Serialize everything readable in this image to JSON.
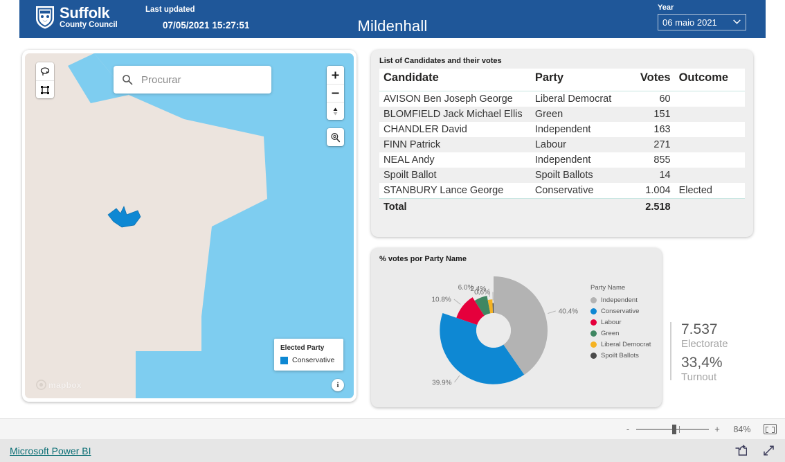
{
  "header": {
    "logo_title": "Suffolk",
    "logo_subtitle": "County Council",
    "last_updated_label": "Last updated",
    "last_updated_value": "07/05/2021 15:27:51",
    "page_title": "Mildenhall",
    "year_label": "Year",
    "year_selected": "06 maio 2021"
  },
  "map": {
    "search_placeholder": "Procurar",
    "zoom_in": "+",
    "zoom_out": "−",
    "legend_title": "Elected Party",
    "legend_item": "Conservative",
    "legend_color": "#0e88d3",
    "attribution": "mapbox",
    "info": "i"
  },
  "table": {
    "title": "List of Candidates and their votes",
    "columns": [
      "Candidate",
      "Party",
      "Votes",
      "Outcome"
    ],
    "rows": [
      {
        "candidate": "AVISON Ben Joseph George",
        "party": "Liberal Democrat",
        "votes": "60",
        "outcome": ""
      },
      {
        "candidate": "BLOMFIELD Jack Michael Ellis",
        "party": "Green",
        "votes": "151",
        "outcome": ""
      },
      {
        "candidate": "CHANDLER David",
        "party": "Independent",
        "votes": "163",
        "outcome": ""
      },
      {
        "candidate": "FINN Patrick",
        "party": "Labour",
        "votes": "271",
        "outcome": ""
      },
      {
        "candidate": "NEAL Andy",
        "party": "Independent",
        "votes": "855",
        "outcome": ""
      },
      {
        "candidate": "Spoilt Ballot",
        "party": "Spoilt Ballots",
        "votes": "14",
        "outcome": ""
      },
      {
        "candidate": "STANBURY Lance George",
        "party": "Conservative",
        "votes": "1.004",
        "outcome": "Elected"
      }
    ],
    "total_label": "Total",
    "total_votes": "2.518"
  },
  "kpi": {
    "electorate_value": "7.537",
    "electorate_label": "Electorate",
    "turnout_value": "33,4%",
    "turnout_label": "Turnout"
  },
  "footer": {
    "zoom_percent": "84%",
    "minus": "-",
    "plus": "+",
    "powerbi_link": "Microsoft Power BI"
  },
  "chart_data": {
    "type": "pie",
    "title": "% votes por Party Name",
    "legend_title": "Party Name",
    "legend_position": "right",
    "categories": [
      "Independent",
      "Conservative",
      "Labour",
      "Green",
      "Liberal Democrat",
      "Spoilt Ballots"
    ],
    "values": [
      40.4,
      39.9,
      10.8,
      6.0,
      2.4,
      0.6
    ],
    "labels": [
      "40.4%",
      "39.9%",
      "10.8%",
      "6.0%",
      "2.4%",
      "0.6%"
    ],
    "colors": [
      "#b3b3b3",
      "#0e88d3",
      "#e5003c",
      "#3f8762",
      "#f5b323",
      "#4a4a4a"
    ],
    "xlabel": "",
    "ylabel": ""
  }
}
